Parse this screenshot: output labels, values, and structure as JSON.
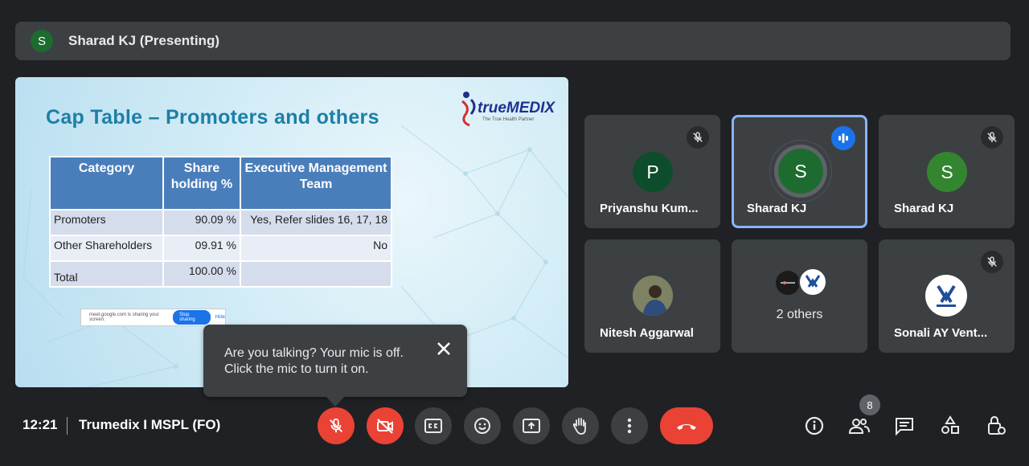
{
  "presenter": {
    "avatar_letter": "S",
    "label": "Sharad KJ (Presenting)"
  },
  "slide": {
    "title": "Cap Table – Promoters and others",
    "logo_text": "trueMEDIX",
    "logo_tagline": "The True Health Partner",
    "table": {
      "headers": [
        "Category",
        "Share holding %",
        "Executive Management Team"
      ],
      "rows": [
        [
          "Promoters",
          "90.09 %",
          "Yes, Refer slides 16, 17, 18"
        ],
        [
          "Other Shareholders",
          "09.91 %",
          "No"
        ],
        [
          "Total",
          "100.00 %",
          ""
        ]
      ]
    },
    "share_strip": {
      "text": "meet.google.com is sharing your screen.",
      "stop": "Stop sharing",
      "hide": "Hide"
    }
  },
  "tooltip": {
    "text": "Are you talking? Your mic is off. Click the mic to turn it on."
  },
  "tiles": [
    {
      "name": "Priyanshu Kum...",
      "avatar_letter": "P",
      "avatar_color": "#0d4d2b"
    },
    {
      "name": "Sharad KJ",
      "avatar_letter": "S",
      "avatar_color": "#1e6b30"
    },
    {
      "name": "Sharad KJ",
      "avatar_letter": "S",
      "avatar_color": "#33862f"
    },
    {
      "name": "Nitesh Aggarwal"
    },
    {
      "others_label": "2 others"
    },
    {
      "name": "Sonali AY Vent..."
    }
  ],
  "bottom_bar": {
    "time": "12:21",
    "meeting_name": "Trumedix I MSPL (FO)",
    "participants_count": "8"
  },
  "colors": {
    "accent": "#8ab4f8",
    "danger": "#ea4335",
    "speaking": "#1a73e8"
  }
}
